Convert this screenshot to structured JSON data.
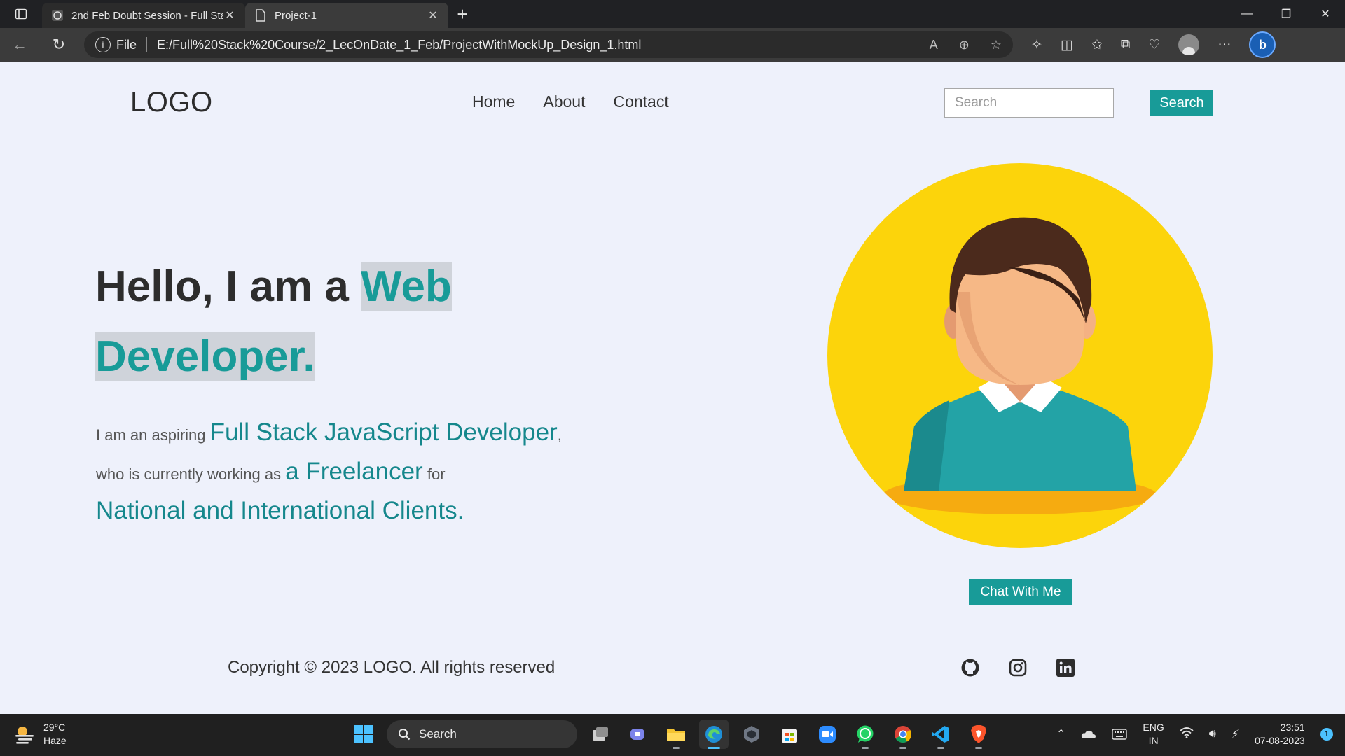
{
  "browser": {
    "tabs": [
      {
        "label": "2nd Feb Doubt Session - Full Sta",
        "icon": "web-page-icon"
      },
      {
        "label": "Project-1",
        "icon": "document-icon"
      }
    ],
    "address": {
      "scheme_label": "File",
      "url": "E:/Full%20Stack%20Course/2_LecOnDate_1_Feb/ProjectWithMockUp_Design_1.html"
    }
  },
  "site": {
    "logo": "LOGO",
    "nav": [
      "Home",
      "About",
      "Contact"
    ],
    "search": {
      "placeholder": "Search",
      "button": "Search"
    },
    "hero": {
      "prefix": "Hello, I am a",
      "highlight_1": "Web",
      "highlight_2": "Developer.",
      "sub_1": "I am an aspiring",
      "sub_em_1": "Full Stack JavaScript Developer",
      "sub_comma": ",",
      "sub_2": "who is currently working as",
      "sub_em_2": "a Freelancer",
      "sub_3": "for",
      "sub_em_3": "National and International Clients."
    },
    "chat_button": "Chat With Me",
    "footer": {
      "copyright": "Copyright © 2023 LOGO. All rights reserved",
      "socials": [
        "github-icon",
        "instagram-icon",
        "linkedin-icon"
      ]
    },
    "colors": {
      "accent": "#189b98",
      "background": "#eef1fb",
      "avatar_circle": "#fcd40b"
    }
  },
  "taskbar": {
    "weather": {
      "temp": "29°C",
      "condition": "Haze"
    },
    "search_label": "Search",
    "lang_1": "ENG",
    "lang_2": "IN",
    "time": "23:51",
    "date": "07-08-2023",
    "notification_count": "1"
  }
}
